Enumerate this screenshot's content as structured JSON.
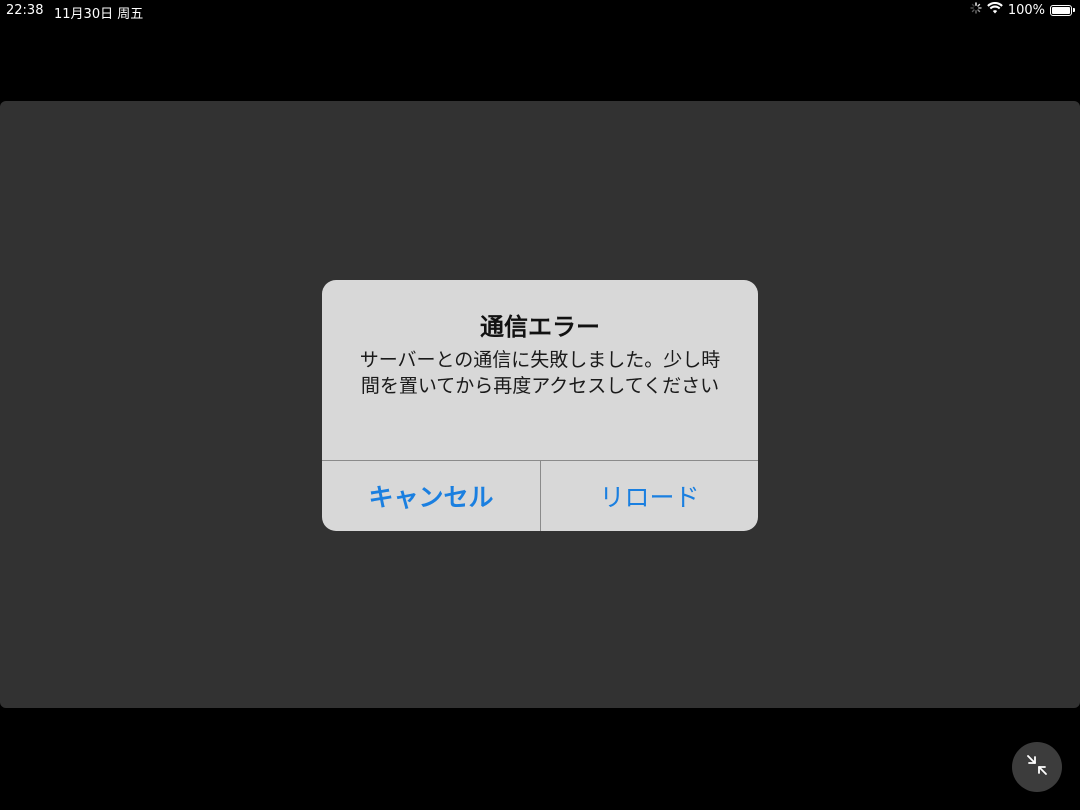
{
  "status_bar": {
    "time": "22:38",
    "date": "11月30日 周五",
    "battery_percent": "100%",
    "battery_level": 1.0,
    "icons": [
      "activity-spinner-icon",
      "wifi-icon",
      "battery-icon"
    ]
  },
  "alert": {
    "title": "通信エラー",
    "message": "サーバーとの通信に失敗しました。少し時間を置いてから再度アクセスしてください",
    "cancel_label": "キャンセル",
    "reload_label": "リロード"
  },
  "floating": {
    "icon": "collapse-arrows-icon"
  },
  "colors": {
    "background": "#000000",
    "panel": "#323232",
    "alert_bg": "#d8d8d8",
    "button_text": "#1a7fe0"
  }
}
